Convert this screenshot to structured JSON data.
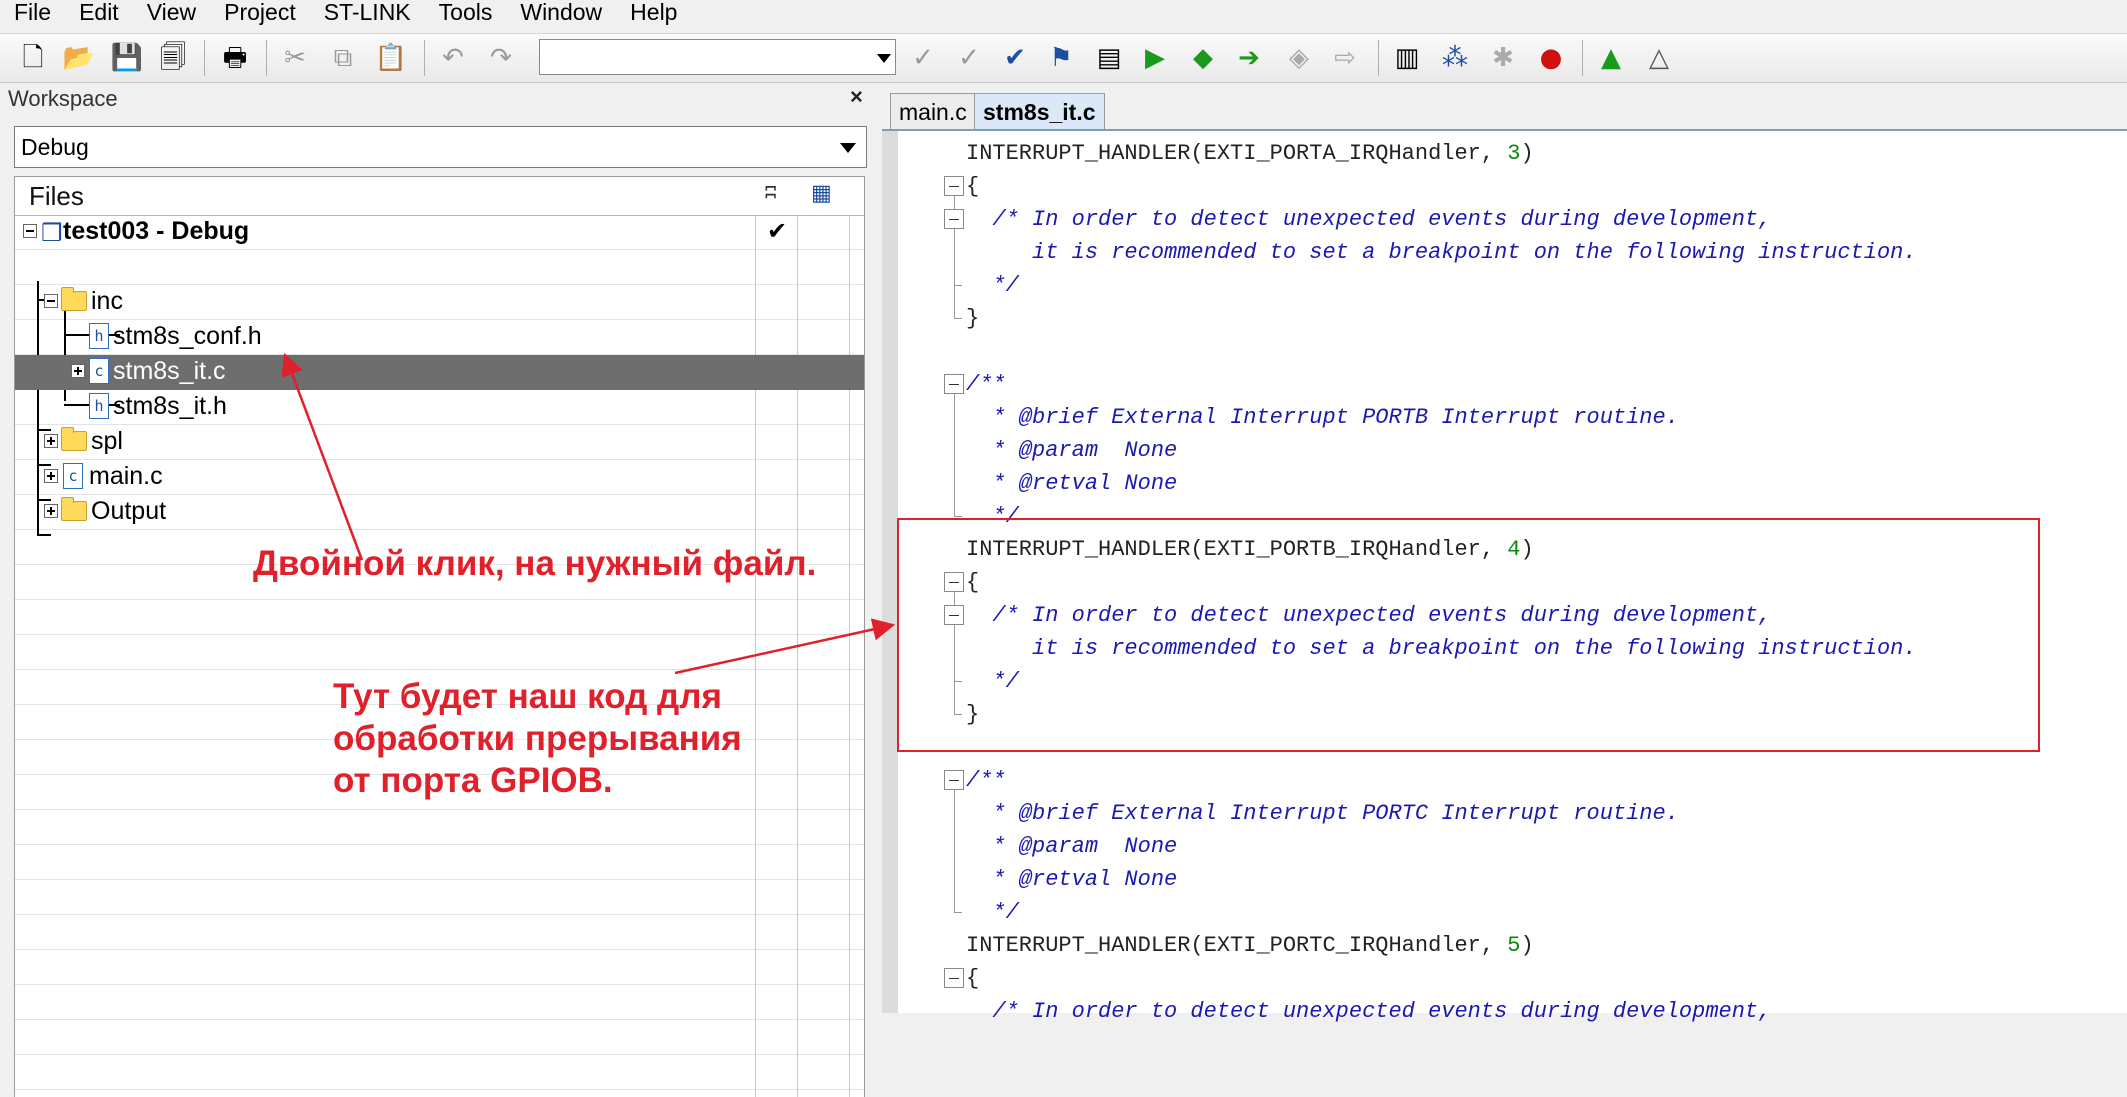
{
  "menu": [
    "File",
    "Edit",
    "View",
    "Project",
    "ST-LINK",
    "Tools",
    "Window",
    "Help"
  ],
  "workspace": {
    "title": "Workspace",
    "close_label": "×",
    "configuration": "Debug",
    "files_header": "Files",
    "tree": [
      {
        "label": "test003 - Debug",
        "type": "project",
        "bold": true,
        "checked": true
      },
      {
        "label": "inc",
        "type": "folder"
      },
      {
        "label": "stm8s_conf.h",
        "type": "file-h"
      },
      {
        "label": "stm8s_it.c",
        "type": "file-c",
        "selected": true
      },
      {
        "label": "stm8s_it.h",
        "type": "file-h"
      },
      {
        "label": "spl",
        "type": "folder"
      },
      {
        "label": "main.c",
        "type": "file-c"
      },
      {
        "label": "Output",
        "type": "folder"
      }
    ]
  },
  "editor": {
    "tabs": [
      {
        "label": "main.c",
        "active": false
      },
      {
        "label": "stm8s_it.c",
        "active": true
      }
    ],
    "lines": [
      {
        "pre": "INTERRUPT_HANDLER(EXTI_PORTA_IRQHandler, ",
        "num": "3",
        "post": ")",
        "kind": "code"
      },
      {
        "text": "{",
        "kind": "code"
      },
      {
        "text": "  /* In order to detect unexpected events during development,",
        "kind": "comment"
      },
      {
        "text": "     it is recommended to set a breakpoint on the following instruction.",
        "kind": "comment"
      },
      {
        "text": "  */",
        "kind": "comment"
      },
      {
        "text": "}",
        "kind": "code"
      },
      {
        "text": "",
        "kind": "code"
      },
      {
        "text": "/**",
        "kind": "comment"
      },
      {
        "text": "  * @brief External Interrupt PORTB Interrupt routine.",
        "kind": "comment"
      },
      {
        "text": "  * @param  None",
        "kind": "comment"
      },
      {
        "text": "  * @retval None",
        "kind": "comment"
      },
      {
        "text": "  */",
        "kind": "comment"
      },
      {
        "pre": "INTERRUPT_HANDLER(EXTI_PORTB_IRQHandler, ",
        "num": "4",
        "post": ")",
        "kind": "code"
      },
      {
        "text": "{",
        "kind": "code"
      },
      {
        "text": "  /* In order to detect unexpected events during development,",
        "kind": "comment"
      },
      {
        "text": "     it is recommended to set a breakpoint on the following instruction.",
        "kind": "comment"
      },
      {
        "text": "  */",
        "kind": "comment"
      },
      {
        "text": "}",
        "kind": "code"
      },
      {
        "text": "",
        "kind": "code"
      },
      {
        "text": "/**",
        "kind": "comment"
      },
      {
        "text": "  * @brief External Interrupt PORTC Interrupt routine.",
        "kind": "comment"
      },
      {
        "text": "  * @param  None",
        "kind": "comment"
      },
      {
        "text": "  * @retval None",
        "kind": "comment"
      },
      {
        "text": "  */",
        "kind": "comment"
      },
      {
        "pre": "INTERRUPT_HANDLER(EXTI_PORTC_IRQHandler, ",
        "num": "5",
        "post": ")",
        "kind": "code"
      },
      {
        "text": "{",
        "kind": "code"
      },
      {
        "text": "  /* In order to detect unexpected events during development,",
        "kind": "comment"
      }
    ]
  },
  "annotations": {
    "double_click": "Двойной клик, на нужный файл.",
    "code_here": [
      "Тут будет наш код для",
      "обработки прерывания",
      "от порта GPIOB."
    ]
  },
  "colors": {
    "annotation": "#e0202a",
    "comment": "#1a1ab0",
    "number": "#0a8a0a",
    "selected_row": "#6e6e6e"
  }
}
